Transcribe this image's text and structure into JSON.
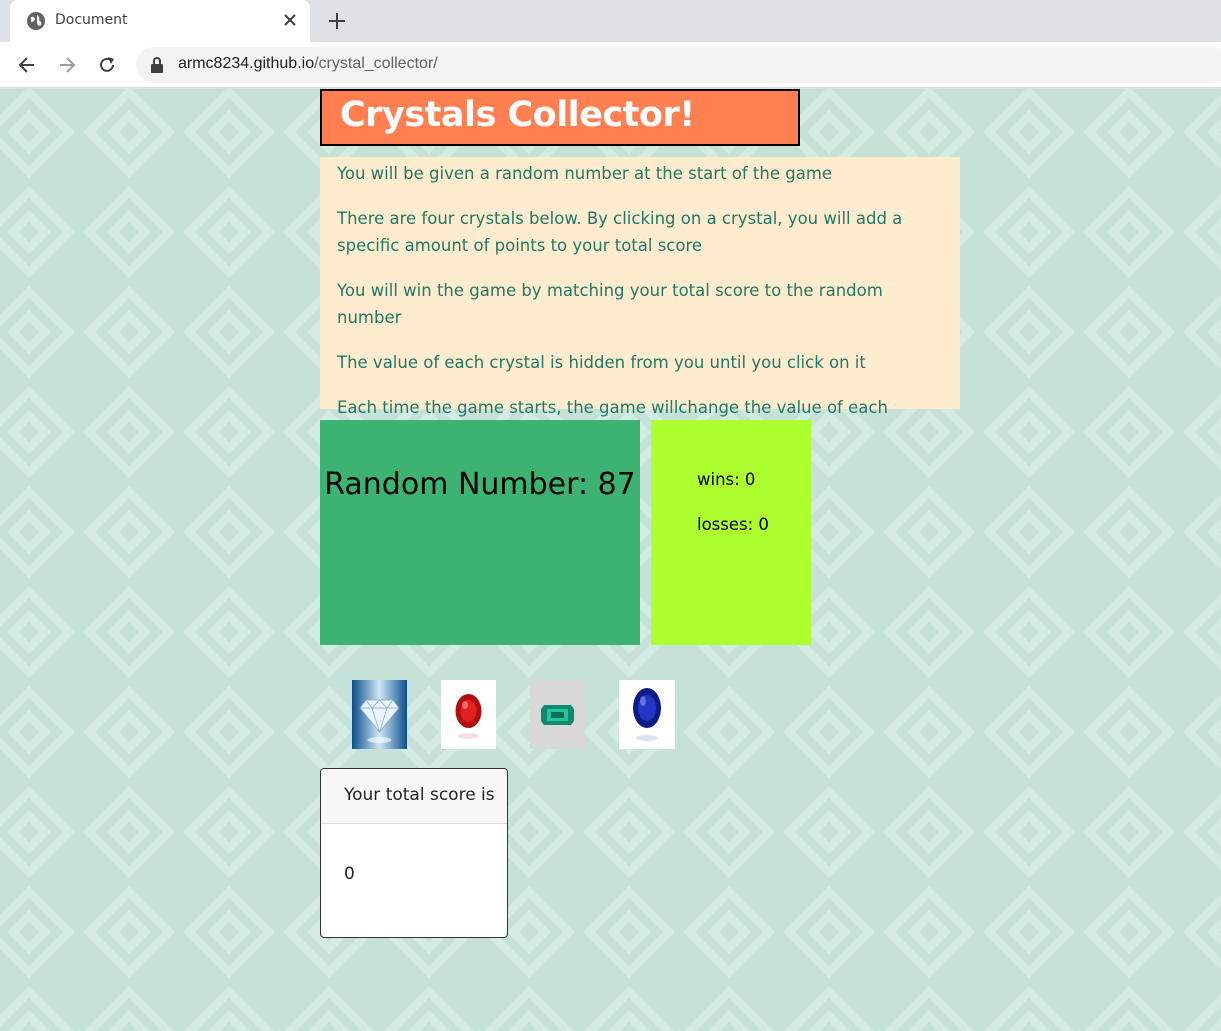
{
  "browser": {
    "tab_title": "Document",
    "url_host": "armc8234.github.io",
    "url_path": "/crystal_collector/"
  },
  "page": {
    "title": "Crystals Collector!",
    "instructions": [
      "You will be given a random number at the start of the game",
      "There are four crystals below. By clicking on a crystal, you will add a specific amount of points to your total score",
      "You will win the game by matching your total score to the random number",
      "The value of each crystal is hidden from you until you click on it",
      "Each time the game starts, the game willchange the value of each crystal"
    ],
    "random_label": "Random Number: 87",
    "wins": "wins: 0",
    "losses": "losses: 0",
    "crystals": [
      "diamond",
      "ruby",
      "emerald",
      "sapphire"
    ],
    "total_header": "Your total score is",
    "total_value": "0"
  },
  "colors": {
    "title_bg": "#ff7f50",
    "instructions_bg": "#ffebcd",
    "instructions_text": "#1f7a6a",
    "random_bg": "#3cb371",
    "score_bg": "#adff2f",
    "page_bg": "#c9e5dc"
  }
}
